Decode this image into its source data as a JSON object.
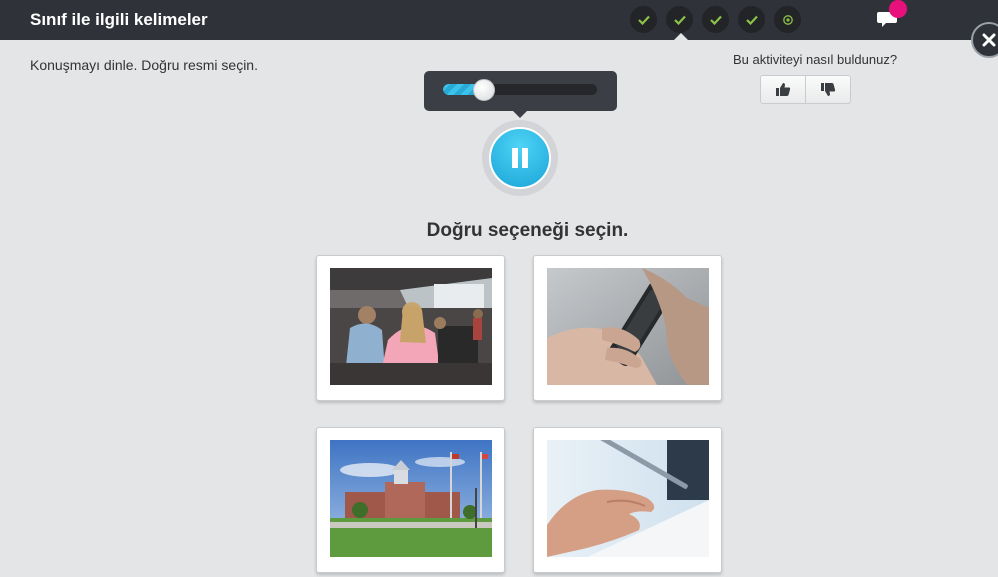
{
  "header": {
    "title": "Sınıf ile ilgili kelimeler",
    "progress": [
      {
        "state": "done",
        "icon": "check-icon"
      },
      {
        "state": "done",
        "icon": "check-icon"
      },
      {
        "state": "done",
        "icon": "check-icon"
      },
      {
        "state": "done",
        "icon": "check-icon"
      },
      {
        "state": "current",
        "icon": "target-icon"
      }
    ],
    "current_index": 2,
    "chat_icon": "chat-bubble-icon",
    "close_icon": "close-icon"
  },
  "activity": {
    "instruction": "Konuşmayı dinle. Doğru resmi seçin.",
    "question": "Doğru seçeneği seçin.",
    "audio": {
      "progress": 0.2,
      "state": "playing"
    }
  },
  "feedback": {
    "question": "Bu aktiviteyi nasıl buldunuz?",
    "like_icon": "thumbs-up-icon",
    "dislike_icon": "thumbs-down-icon"
  },
  "options": [
    {
      "id": "option-classroom",
      "image": "classroom-lecture-photo"
    },
    {
      "id": "option-phone",
      "image": "hand-holding-phone-photo"
    },
    {
      "id": "option-school",
      "image": "school-building-photo"
    },
    {
      "id": "option-writing",
      "image": "hand-writing-with-pen-photo"
    }
  ],
  "colors": {
    "topbar": "#2f3238",
    "accent": "#29a9d6",
    "check": "#8bc34a",
    "badge": "#e8107d",
    "background": "#e4e5e7"
  }
}
